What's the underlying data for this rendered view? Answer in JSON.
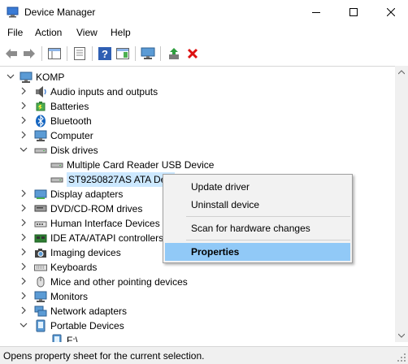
{
  "window": {
    "title": "Device Manager",
    "minimize_glyph": "—",
    "maximize_glyph": "☐",
    "close_glyph": "✕"
  },
  "menu": [
    "File",
    "Action",
    "View",
    "Help"
  ],
  "toolbar": {
    "icons": [
      "back-arrow-icon",
      "forward-arrow-icon",
      "show-hide-console-tree-icon",
      "properties-icon",
      "help-icon",
      "action-pane-icon",
      "monitor-icon",
      "update-driver-icon",
      "uninstall-icon"
    ]
  },
  "tree": {
    "root": "KOMP",
    "categories": [
      {
        "label": "Audio inputs and outputs",
        "expanded": false,
        "icon": "speaker-icon"
      },
      {
        "label": "Batteries",
        "expanded": false,
        "icon": "battery-icon"
      },
      {
        "label": "Bluetooth",
        "expanded": false,
        "icon": "bluetooth-icon"
      },
      {
        "label": "Computer",
        "expanded": false,
        "icon": "computer-icon"
      },
      {
        "label": "Disk drives",
        "expanded": true,
        "icon": "disk-drive-icon"
      },
      {
        "label": "Display adapters",
        "expanded": false,
        "icon": "display-adapter-icon"
      },
      {
        "label": "DVD/CD-ROM drives",
        "expanded": false,
        "icon": "dvd-drive-icon"
      },
      {
        "label": "Human Interface Devices",
        "expanded": false,
        "icon": "hid-icon"
      },
      {
        "label": "IDE ATA/ATAPI controllers",
        "expanded": false,
        "icon": "ide-controller-icon"
      },
      {
        "label": "Imaging devices",
        "expanded": false,
        "icon": "camera-icon"
      },
      {
        "label": "Keyboards",
        "expanded": false,
        "icon": "keyboard-icon"
      },
      {
        "label": "Mice and other pointing devices",
        "expanded": false,
        "icon": "mouse-icon"
      },
      {
        "label": "Monitors",
        "expanded": false,
        "icon": "monitor-icon"
      },
      {
        "label": "Network adapters",
        "expanded": false,
        "icon": "network-adapter-icon"
      },
      {
        "label": "Portable Devices",
        "expanded": true,
        "icon": "portable-device-icon"
      }
    ],
    "disk_children": [
      "Multiple Card  Reader USB Device",
      "ST9250827AS ATA Devi"
    ],
    "portable_children": [
      "F:\\"
    ]
  },
  "context_menu": {
    "items": [
      "Update driver",
      "Uninstall device",
      "Scan for hardware changes",
      "Properties"
    ],
    "active": "Properties"
  },
  "status": "Opens property sheet for the current selection."
}
